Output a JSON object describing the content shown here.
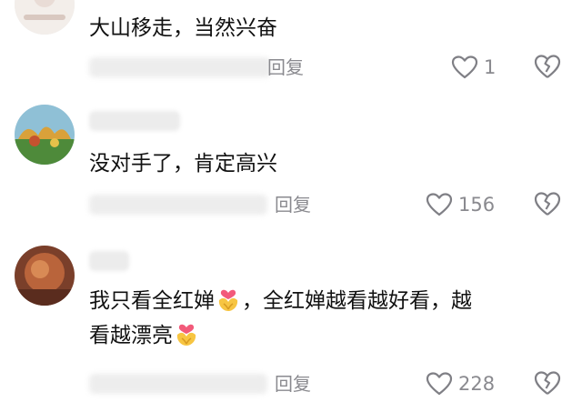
{
  "comments": [
    {
      "text": "大山移走，当然兴奋",
      "reply_label": "回复",
      "like_count": "1"
    },
    {
      "text": "没对手了，肯定高兴",
      "reply_label": "回复",
      "like_count": "156"
    },
    {
      "text_parts": [
        "我只看全红婵",
        "，全红婵越看越好看，越",
        "看越漂亮"
      ],
      "reply_label": "回复",
      "like_count": "228"
    }
  ],
  "icons": {
    "like": "heart-outline-icon",
    "dislike": "broken-heart-icon",
    "emoji": "heart-hands-emoji"
  },
  "colors": {
    "text": "#111111",
    "meta": "#8a8a8f",
    "background": "#ffffff"
  }
}
